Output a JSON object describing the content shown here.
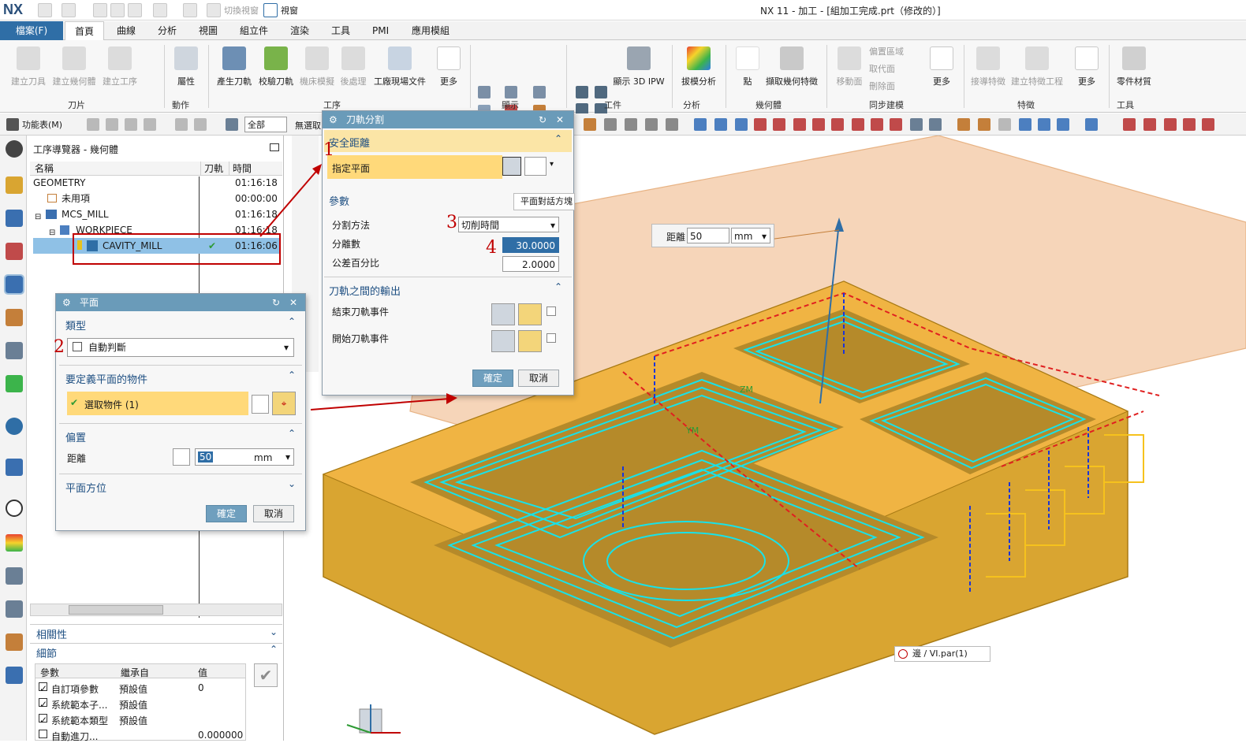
{
  "titlebar": {
    "logo": "NX",
    "switch_window": "切換視窗",
    "window_menu": "視窗",
    "title": "NX 11 - 加工 - [組加工完成.prt（修改的）]"
  },
  "menubar": {
    "file": "檔案(F)",
    "tabs": [
      "首頁",
      "曲線",
      "分析",
      "視圖",
      "組立件",
      "渲染",
      "工具",
      "PMI",
      "應用模組"
    ]
  },
  "ribbon": {
    "buttons": [
      "建立刀具",
      "建立幾何體",
      "建立工序",
      "屬性",
      "產生刀軌",
      "校驗刀軌",
      "機床模擬",
      "後處理",
      "工廠現場文件",
      "更多",
      "顯示 3D IPW",
      "拔模分析",
      "點",
      "擷取幾何特徵",
      "移動面",
      "偏置區域",
      "取代面",
      "刪除面",
      "更多",
      "接導特徵",
      "建立特徵工程",
      "更多",
      "零件材質"
    ],
    "groups": [
      "刀片",
      "動作",
      "工序",
      "顯示",
      "工件",
      "分析",
      "幾何體",
      "同步建模",
      "特徵",
      "工具"
    ]
  },
  "toolbar2": {
    "function_menu": "功能表(M)",
    "filter_value": "全部",
    "filter2": "無選取"
  },
  "navigator": {
    "title": "工序導覽器 - 幾何體",
    "columns": [
      "名稱",
      "刀軌",
      "時間"
    ],
    "rows": [
      {
        "name": "GEOMETRY",
        "time": "01:16:18"
      },
      {
        "name": "未用項",
        "time": "00:00:00"
      },
      {
        "name": "MCS_MILL",
        "time": "01:16:18"
      },
      {
        "name": "WORKPIECE",
        "time": "01:16:18"
      },
      {
        "name": "CAVITY_MILL",
        "time": "01:16:06"
      }
    ],
    "dependency": "相關性",
    "details": "細節",
    "detail_columns": [
      "參數",
      "繼承自",
      "值"
    ],
    "detail_rows": [
      {
        "param": "自訂項參數",
        "from": "預設值",
        "value": "0"
      },
      {
        "param": "系統範本子...",
        "from": "預設值",
        "value": ""
      },
      {
        "param": "系統範本類型",
        "from": "預設值",
        "value": ""
      },
      {
        "param": "自動進刀...",
        "from": "",
        "value": "0.000000"
      }
    ]
  },
  "dialog_split": {
    "title": "刀軌分割",
    "safety": "安全距離",
    "specify_plane": "指定平面",
    "plane_dialog_btn": "平面對話方塊",
    "params": "參數",
    "split_method_label": "分割方法",
    "split_method_value": "切削時間",
    "split_count_label": "分離數",
    "split_count_value": "30.0000",
    "tolerance_label": "公差百分比",
    "tolerance_value": "2.0000",
    "output": "刀軌之間的輸出",
    "end_event": "結束刀軌事件",
    "start_event": "開始刀軌事件",
    "ok": "確定",
    "cancel": "取消"
  },
  "dialog_plane": {
    "title": "平面",
    "type": "類型",
    "type_value": "自動判斷",
    "objects": "要定義平面的物件",
    "select_obj": "選取物件 (1)",
    "offset": "偏置",
    "distance_label": "距離",
    "distance_value": "50",
    "unit": "mm",
    "orientation": "平面方位",
    "ok": "確定",
    "cancel": "取消"
  },
  "viewport": {
    "distance_label": "距離",
    "distance_value": "50",
    "unit": "mm",
    "edge_tag": "邊 / VI.par(1)",
    "axis_labels": [
      "ZM",
      "YM"
    ]
  },
  "markers": [
    "1",
    "2",
    "3",
    "4"
  ],
  "colors": {
    "accent": "#2f6ea6",
    "dialog_header": "#6a9bb9",
    "highlight": "#ffd97a",
    "part": "#d9a531",
    "toolpath": "#19e2e8",
    "plane": "#f3c7a2",
    "marker": "#c00000"
  }
}
